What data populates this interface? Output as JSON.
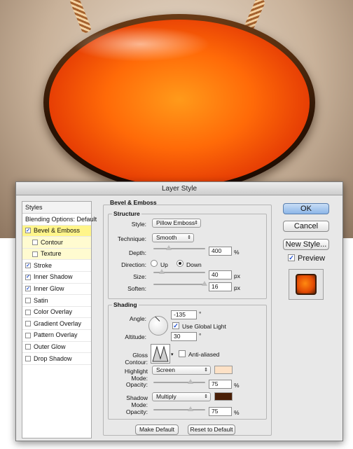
{
  "dialog": {
    "title": "Layer Style",
    "styles_header": "Styles",
    "blending": "Blending Options: Default",
    "items": [
      {
        "label": "Bevel & Emboss",
        "checked": true
      },
      {
        "label": "Contour",
        "checked": false
      },
      {
        "label": "Texture",
        "checked": false
      },
      {
        "label": "Stroke",
        "checked": true
      },
      {
        "label": "Inner Shadow",
        "checked": true
      },
      {
        "label": "Inner Glow",
        "checked": true
      },
      {
        "label": "Satin",
        "checked": false
      },
      {
        "label": "Color Overlay",
        "checked": false
      },
      {
        "label": "Gradient Overlay",
        "checked": false
      },
      {
        "label": "Pattern Overlay",
        "checked": false
      },
      {
        "label": "Outer Glow",
        "checked": false
      },
      {
        "label": "Drop Shadow",
        "checked": false
      }
    ]
  },
  "bevel": {
    "title": "Bevel & Emboss",
    "structure": "Structure",
    "style_label": "Style:",
    "style_value": "Pillow Emboss",
    "technique_label": "Technique:",
    "technique_value": "Smooth",
    "depth_label": "Depth:",
    "depth_value": "400",
    "depth_unit": "%",
    "direction_label": "Direction:",
    "dir_up": "Up",
    "dir_down": "Down",
    "size_label": "Size:",
    "size_value": "40",
    "size_unit": "px",
    "soften_label": "Soften:",
    "soften_value": "16",
    "soften_unit": "px"
  },
  "shading": {
    "title": "Shading",
    "angle_label": "Angle:",
    "angle_value": "-135",
    "degree": "°",
    "global_light": "Use Global Light",
    "altitude_label": "Altitude:",
    "altitude_value": "30",
    "gloss_label": "Gloss Contour:",
    "anti_aliased": "Anti-aliased",
    "highlight_label": "Highlight Mode:",
    "highlight_value": "Screen",
    "opacity_label": "Opacity:",
    "hl_opacity": "75",
    "pct": "%",
    "shadow_label": "Shadow Mode:",
    "shadow_value": "Multiply",
    "sh_opacity": "75",
    "highlight_color": "#fde1c6",
    "shadow_color": "#4a1f07"
  },
  "buttons": {
    "make_default": "Make Default",
    "reset_default": "Reset to Default",
    "ok": "OK",
    "cancel": "Cancel",
    "new_style": "New Style...",
    "preview": "Preview"
  },
  "levels": {
    "depth": 0.3,
    "size": 0.16,
    "soften": 0.98,
    "hl_opacity": 0.72,
    "sh_opacity": 0.72
  }
}
